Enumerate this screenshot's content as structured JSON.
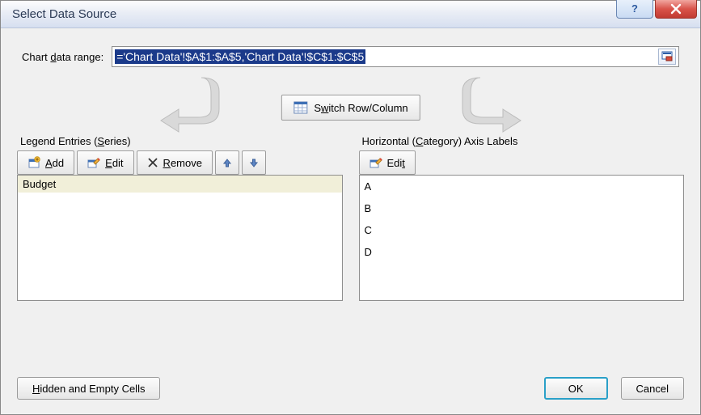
{
  "title": "Select Data Source",
  "range": {
    "label_pre": "Chart ",
    "label_u": "d",
    "label_post": "ata range:",
    "value": "='Chart Data'!$A$1:$A$5,'Chart Data'!$C$1:$C$5"
  },
  "switch": {
    "label_pre": "S",
    "label_u": "w",
    "label_post": "itch Row/Column"
  },
  "legend": {
    "title_pre": "Legend Entries (",
    "title_u": "S",
    "title_post": "eries)",
    "add_u": "A",
    "add_post": "dd",
    "edit_u": "E",
    "edit_post": "dit",
    "remove_u": "R",
    "remove_post": "emove",
    "items": [
      "Budget"
    ]
  },
  "axis": {
    "title_pre": "Horizontal (",
    "title_u": "C",
    "title_post": "ategory) Axis Labels",
    "edit_pre": "Edi",
    "edit_u": "t",
    "items": [
      "A",
      "B",
      "C",
      "D"
    ]
  },
  "bottom": {
    "hidden_u": "H",
    "hidden_post": "idden and Empty Cells",
    "ok": "OK",
    "cancel": "Cancel"
  }
}
